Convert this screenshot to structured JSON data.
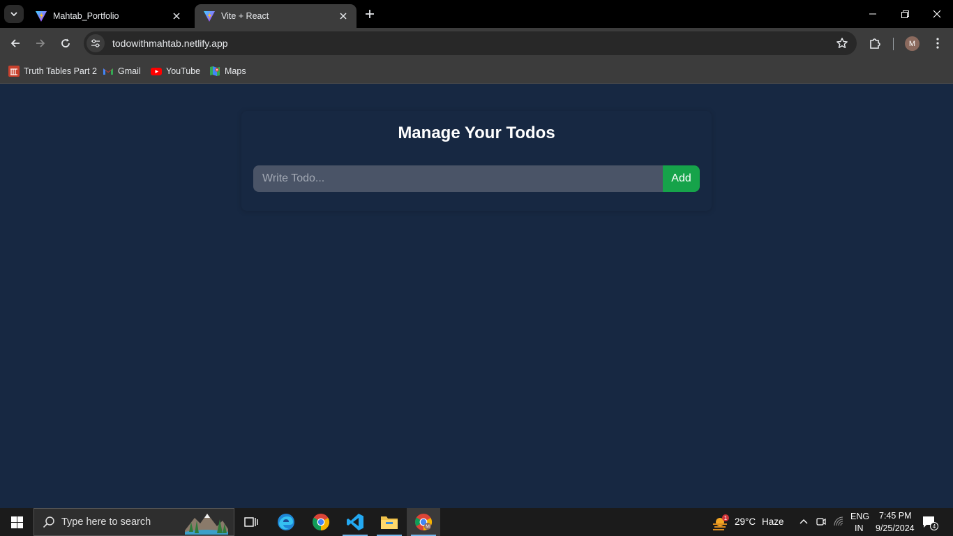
{
  "browser": {
    "tabs": [
      {
        "title": "Mahtab_Portfolio",
        "favicon": "vite-icon",
        "active": false
      },
      {
        "title": "Vite + React",
        "favicon": "vite-icon",
        "active": true
      }
    ],
    "url": "todowithmahtab.netlify.app",
    "profile_initial": "M",
    "bookmarks": [
      {
        "label": "Truth Tables Part 2",
        "icon": "bookmark-site-icon"
      },
      {
        "label": "Gmail",
        "icon": "gmail-icon"
      },
      {
        "label": "YouTube",
        "icon": "youtube-icon"
      },
      {
        "label": "Maps",
        "icon": "maps-icon"
      }
    ]
  },
  "app": {
    "heading": "Manage Your Todos",
    "input_placeholder": "Write Todo...",
    "add_label": "Add"
  },
  "taskbar": {
    "search_placeholder": "Type here to search",
    "weather_temp": "29°C",
    "weather_desc": "Haze",
    "weather_badge": "1",
    "lang_line1": "ENG",
    "lang_line2": "IN",
    "time": "7:45 PM",
    "date": "9/25/2024",
    "notification_count": "4"
  },
  "colors": {
    "page_bg": "#172842",
    "input_bg": "#4a5467",
    "add_button": "#16a34a"
  }
}
